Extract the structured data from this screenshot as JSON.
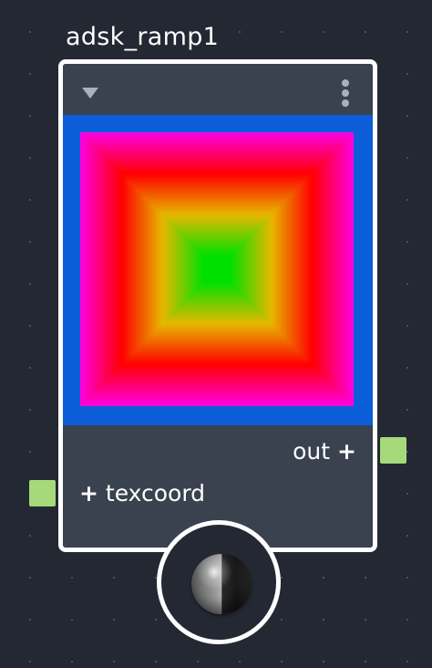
{
  "node": {
    "title": "adsk_ramp1",
    "outputs": [
      {
        "label": "out",
        "plus": "+"
      }
    ],
    "inputs": [
      {
        "label": "texcoord",
        "plus": "+"
      }
    ]
  },
  "icons": {
    "collapse": "triangle-down-icon",
    "menu": "vertical-ellipsis-icon",
    "port_add": "plus-icon",
    "material_preview": "shader-ball-icon"
  },
  "colors": {
    "canvas_background": "#232832",
    "node_body": "#3a4250",
    "node_border": "#ffffff",
    "port_socket": "#a6d97a",
    "ramp_stops": [
      "#0b5ed8",
      "#ff00dd",
      "#ff0000",
      "#e6b800",
      "#00e000"
    ]
  }
}
